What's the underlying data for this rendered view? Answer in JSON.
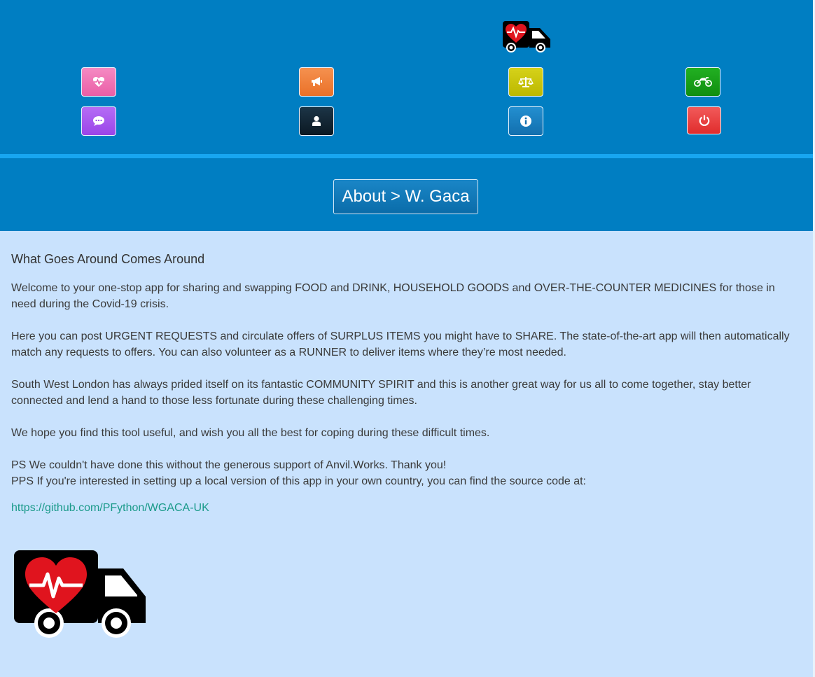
{
  "header": {
    "logo_name": "heart-van-logo",
    "nav_buttons": [
      {
        "name": "health-button",
        "icon": "heart-pulse-icon",
        "color": "#f170b4"
      },
      {
        "name": "announce-button",
        "icon": "megaphone-icon",
        "color": "#f0803a"
      },
      {
        "name": "balance-button",
        "icon": "scales-icon",
        "color": "#c7c400"
      },
      {
        "name": "runner-button",
        "icon": "motorbike-icon",
        "color": "#18a018"
      },
      {
        "name": "chat-button",
        "icon": "chat-bubble-icon",
        "color": "#a855ee"
      },
      {
        "name": "profile-button",
        "icon": "user-icon",
        "color": "#12222f"
      },
      {
        "name": "info-button",
        "icon": "info-icon",
        "color": "#1b7fc1"
      },
      {
        "name": "logout-button",
        "icon": "power-icon",
        "color": "#eb3b3b"
      }
    ]
  },
  "page": {
    "title": "About > W. Gaca"
  },
  "content": {
    "heading": "What Goes Around Comes Around",
    "p1": "Welcome to your one-stop app for sharing and swapping FOOD and DRINK, HOUSEHOLD GOODS and OVER-THE-COUNTER MEDICINES for those in need during the Covid-19 crisis.",
    "p2": "Here you can post URGENT REQUESTS and circulate offers of SURPLUS ITEMS you might have to SHARE. The state-of-the-art app will then automatically match any requests to offers. You can also volunteer as a RUNNER to deliver items where they’re most needed.",
    "p3": "South West London has always prided itself on its fantastic COMMUNITY SPIRIT and this is another great way for us all to come together, stay better connected and lend a hand to those less fortunate during these challenging times.",
    "p4": "We hope you find this tool useful, and wish you all the best for coping during these difficult times.",
    "ps": "PS We couldn't have done this without the generous support of Anvil.Works.  Thank you!",
    "pps": "PPS If you're interested in setting up a local version of this app in your own country, you can find the source code at:",
    "link": "https://github.com/PFython/WGACA-UK"
  },
  "colors": {
    "header_bg": "#007ec2",
    "divider": "#18a6f0",
    "page_bg": "#c9e2fd",
    "link": "#1a9a8a"
  }
}
